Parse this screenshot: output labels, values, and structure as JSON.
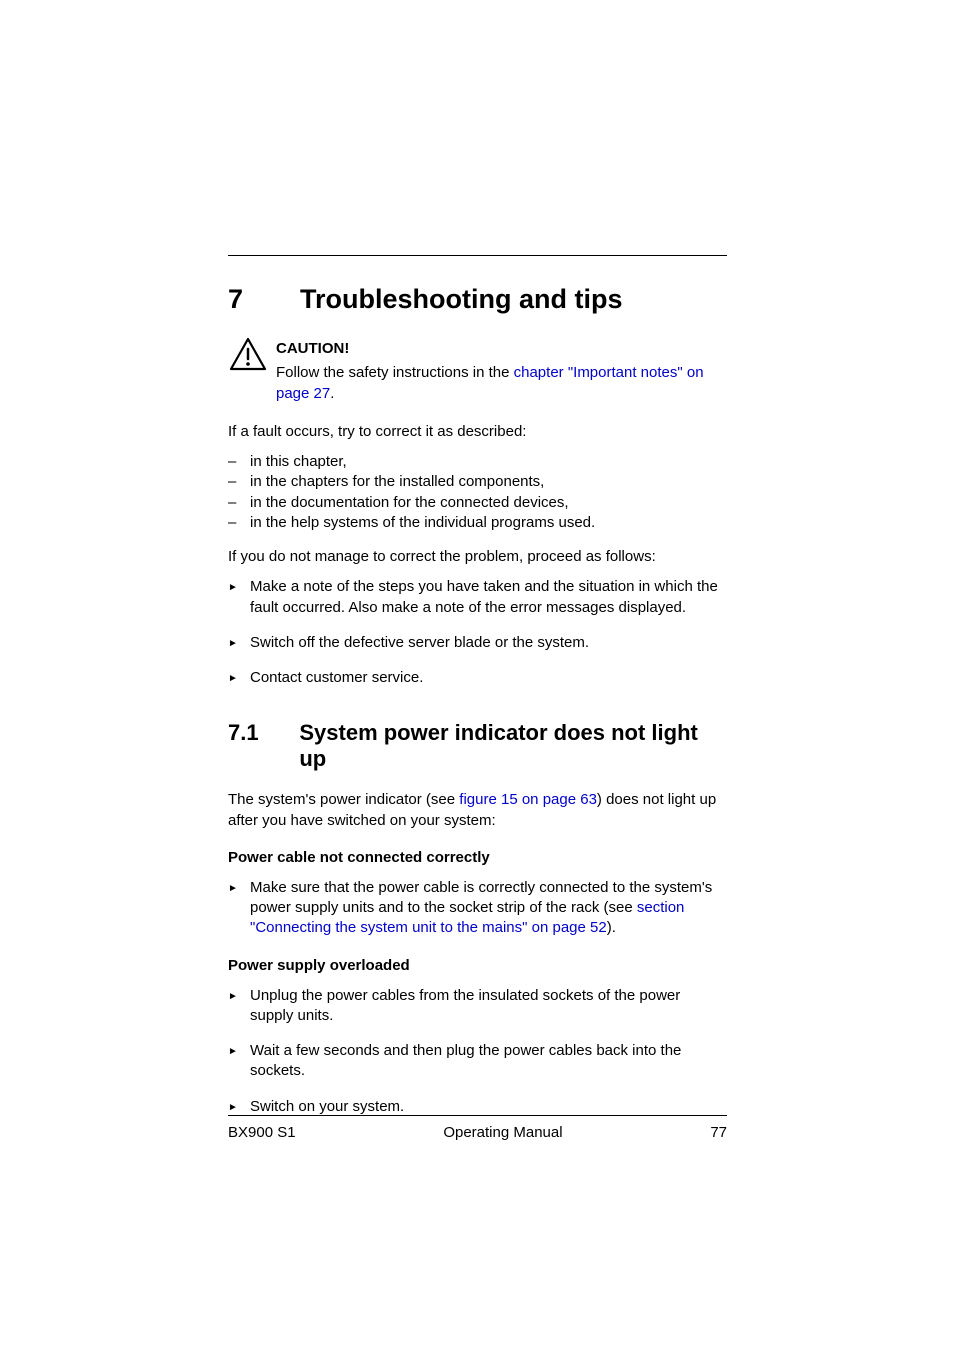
{
  "chapter": {
    "number": "7",
    "title": "Troubleshooting and tips"
  },
  "caution": {
    "label": "CAUTION!",
    "text_before_link": "Follow the safety instructions in the ",
    "link_text": "chapter \"Important notes\" on page 27",
    "text_after_link": "."
  },
  "intro_para": "If a fault occurs, try to correct it as described:",
  "dash_items": [
    "in this chapter,",
    "in the chapters for the installed components,",
    "in the documentation for the connected devices,",
    "in the help systems of the individual programs used."
  ],
  "proceed_para": "If you do not manage to correct the problem, proceed as follows:",
  "arrow_items_1": [
    "Make a note of the steps you have taken and the situation in which the fault occurred. Also make a note of the error messages displayed.",
    "Switch off the defective server blade or the system.",
    "Contact customer service."
  ],
  "section": {
    "number": "7.1",
    "title": "System power indicator does not light up"
  },
  "section_para": {
    "before1": "The system's power indicator (see ",
    "link1": "figure 15 on page 63",
    "after1": ") does not light up after you have switched on your system:"
  },
  "sub1": {
    "heading": "Power cable not connected correctly",
    "item_before": "Make sure that the power cable is correctly connected to the system's power supply units and to the socket strip of the rack (see ",
    "item_link": "section \"Connecting the system unit to the mains\" on page 52",
    "item_after": ")."
  },
  "sub2": {
    "heading": "Power supply overloaded",
    "items": [
      "Unplug the power cables from the insulated sockets of the power supply units.",
      "Wait a few seconds and then plug the power cables back into the sockets.",
      "Switch on your system."
    ]
  },
  "footer": {
    "left": "BX900 S1",
    "center": "Operating Manual",
    "right": "77"
  }
}
